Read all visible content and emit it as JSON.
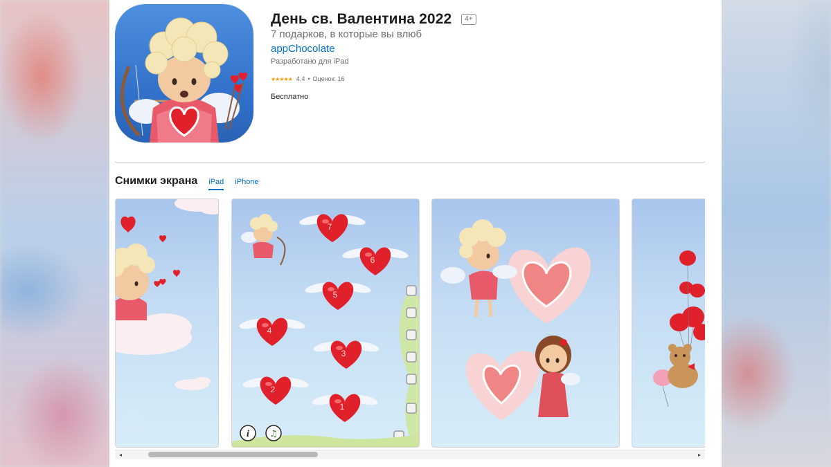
{
  "app": {
    "title": "День св. Валентина 2022",
    "age_rating": "4+",
    "subtitle": "7 подарков, в которые вы влюб",
    "developer": "appChocolate",
    "designed_for": "Разработано для iPad",
    "stars": "★★★★★",
    "rating": "4,4",
    "ratings_count": "Оценок: 16",
    "price": "Бесплатно"
  },
  "screenshots": {
    "title": "Снимки экрана",
    "tabs": [
      {
        "label": "iPad",
        "active": true
      },
      {
        "label": "iPhone",
        "active": false
      }
    ]
  },
  "game_screen": {
    "hearts": [
      "7",
      "6",
      "5",
      "4",
      "3",
      "2",
      "1"
    ]
  },
  "scrollbar": {
    "left_arrow": "◂",
    "right_arrow": "▸"
  },
  "colors": {
    "link": "#0070c9",
    "star": "#ff9500",
    "heart": "#e0202a"
  }
}
